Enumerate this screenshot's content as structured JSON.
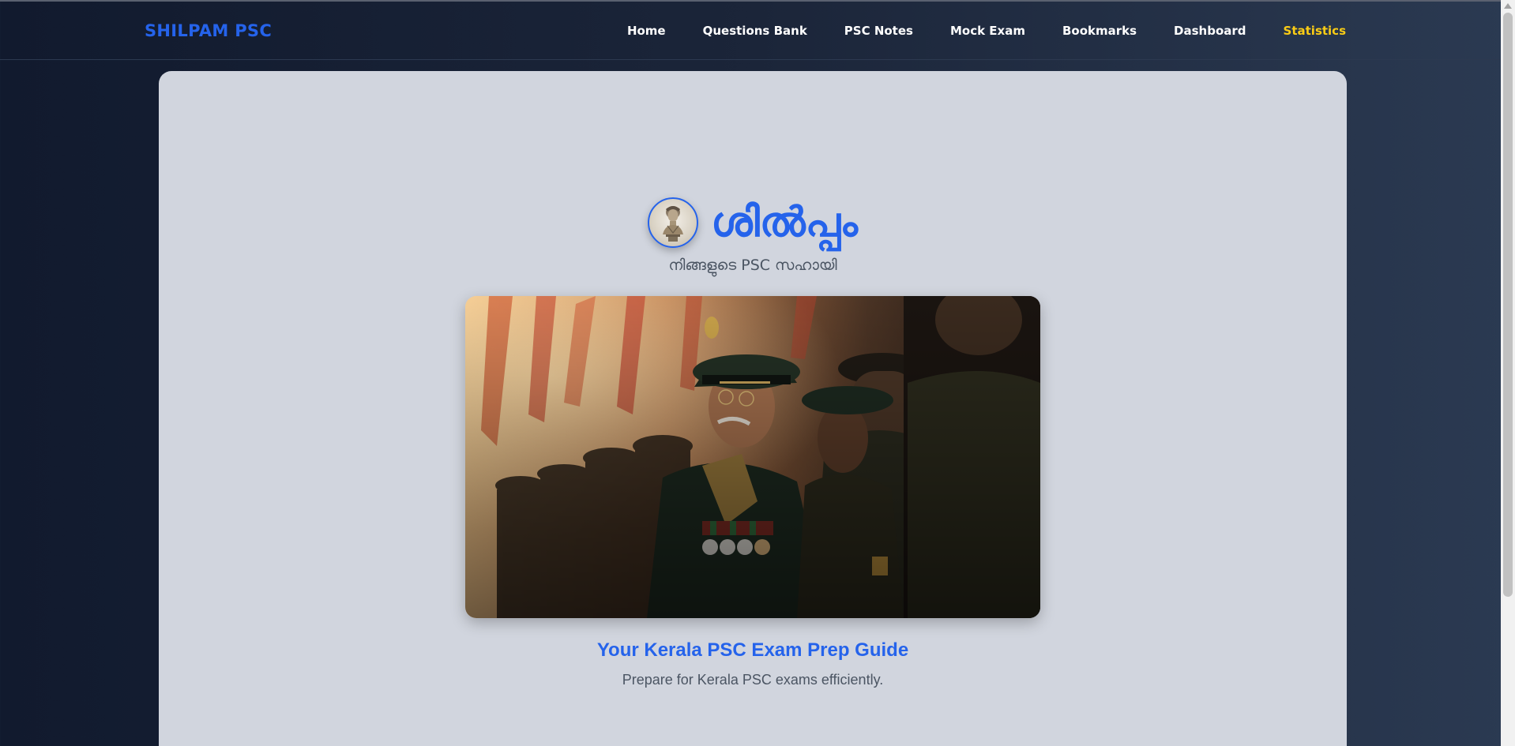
{
  "brand": "SHILPAM PSC",
  "nav": {
    "items": [
      {
        "label": "Home"
      },
      {
        "label": "Questions Bank"
      },
      {
        "label": "PSC Notes"
      },
      {
        "label": "Mock Exam"
      },
      {
        "label": "Bookmarks"
      },
      {
        "label": "Dashboard"
      },
      {
        "label": "Statistics",
        "active": true
      }
    ]
  },
  "hero": {
    "site_name": "ശിൽപ്പം",
    "tagline": "നിങ്ങളുടെ PSC സഹായി",
    "logo_icon": "sculpture-bust-icon",
    "image_icon": "army-officers-image"
  },
  "guide": {
    "title": "Your Kerala PSC Exam Prep Guide",
    "subtitle": "Prepare for Kerala PSC exams efficiently."
  },
  "colors": {
    "accent": "#2563eb",
    "active_nav": "#facc15",
    "card_bg": "#d1d5de"
  }
}
